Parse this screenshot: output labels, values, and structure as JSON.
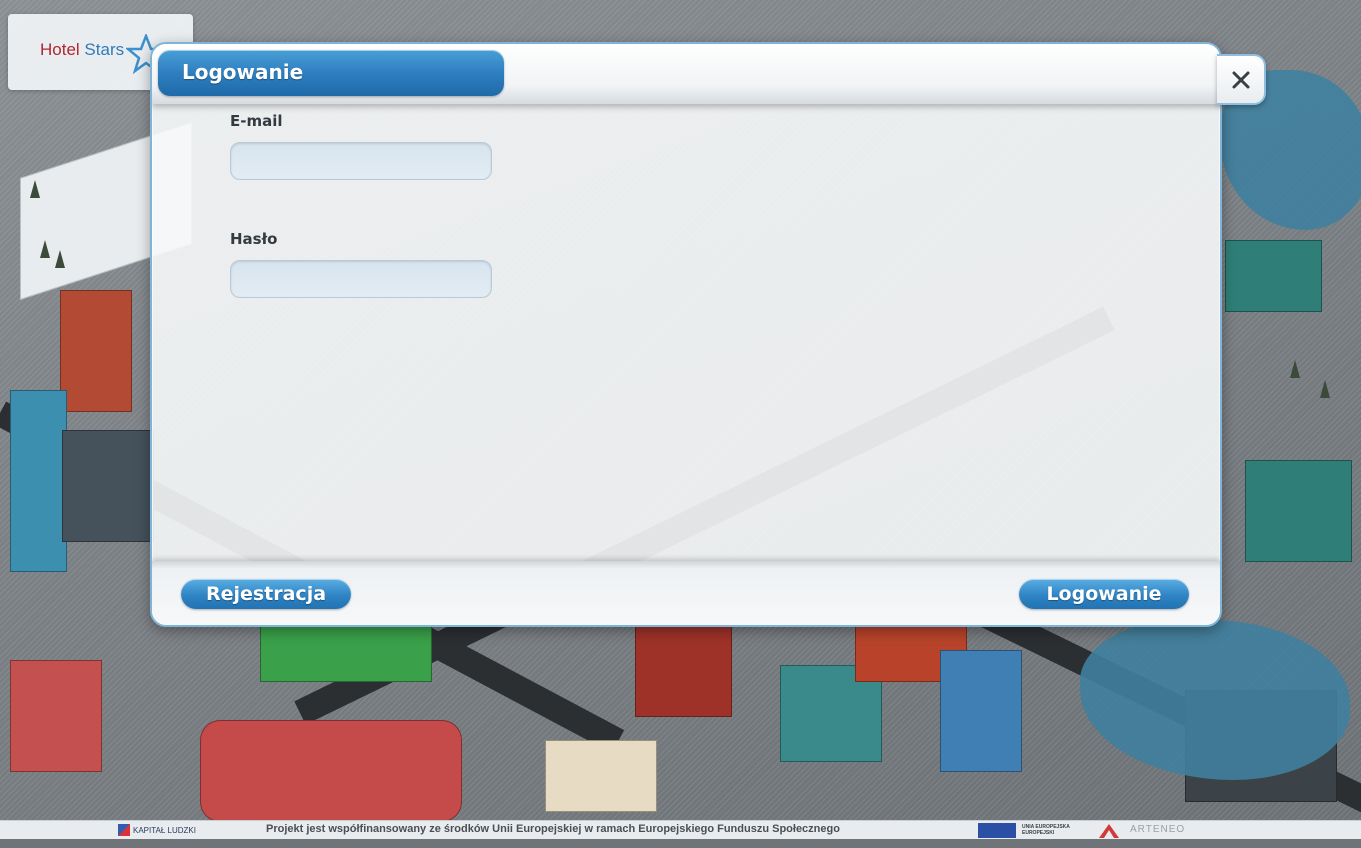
{
  "app": {
    "logo_text_hotel": "Hotel",
    "logo_text_stars": "Stars"
  },
  "modal": {
    "title": "Logowanie",
    "email": {
      "label": "E-mail",
      "value": "",
      "placeholder": ""
    },
    "password": {
      "label": "Hasło",
      "value": "",
      "placeholder": ""
    },
    "register_button": "Rejestracja",
    "login_button": "Logowanie",
    "close_icon": "close-icon"
  },
  "footer": {
    "kapital_ludzki": "KAPITAŁ LUDZKI",
    "funding_text": "Projekt jest współfinansowany ze środków Unii Europejskiej w ramach Europejskiego Funduszu Społecznego",
    "eu_label": "UNIA EUROPEJSKA",
    "eu_sub": "EUROPEJSKI",
    "arteneo": "ARTENEO"
  },
  "colors": {
    "accent_blue": "#2f84c4",
    "logo_red": "#b0262f",
    "logo_blue": "#2f7bb8"
  }
}
